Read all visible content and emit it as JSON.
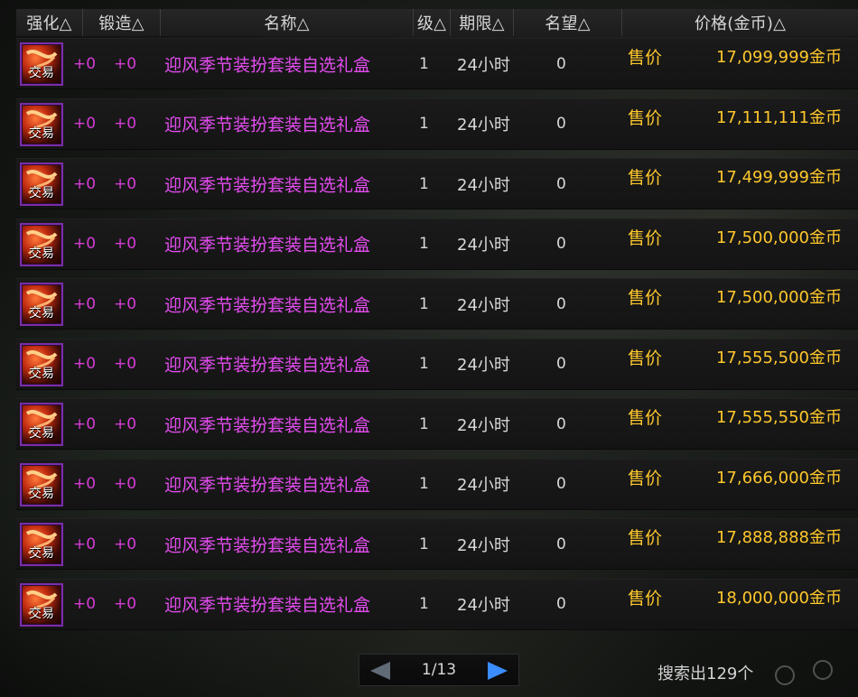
{
  "columns": {
    "qh": "强化△",
    "dz": "锻造△",
    "name": "名称△",
    "level": "级△",
    "term": "期限△",
    "fame": "名望△",
    "price": "价格(金币)△"
  },
  "rows": [
    {
      "icon": "gift-box-icon",
      "trade": "交易",
      "qh": "+0",
      "dz": "+0",
      "name": "迎风季节装扮套装自选礼盒",
      "level": "1",
      "term": "24小时",
      "fame": "0",
      "sale": "售价",
      "price": "17,099,999金币"
    },
    {
      "icon": "gift-box-icon",
      "trade": "交易",
      "qh": "+0",
      "dz": "+0",
      "name": "迎风季节装扮套装自选礼盒",
      "level": "1",
      "term": "24小时",
      "fame": "0",
      "sale": "售价",
      "price": "17,111,111金币"
    },
    {
      "icon": "gift-box-icon",
      "trade": "交易",
      "qh": "+0",
      "dz": "+0",
      "name": "迎风季节装扮套装自选礼盒",
      "level": "1",
      "term": "24小时",
      "fame": "0",
      "sale": "售价",
      "price": "17,499,999金币"
    },
    {
      "icon": "gift-box-icon",
      "trade": "交易",
      "qh": "+0",
      "dz": "+0",
      "name": "迎风季节装扮套装自选礼盒",
      "level": "1",
      "term": "24小时",
      "fame": "0",
      "sale": "售价",
      "price": "17,500,000金币"
    },
    {
      "icon": "gift-box-icon",
      "trade": "交易",
      "qh": "+0",
      "dz": "+0",
      "name": "迎风季节装扮套装自选礼盒",
      "level": "1",
      "term": "24小时",
      "fame": "0",
      "sale": "售价",
      "price": "17,500,000金币"
    },
    {
      "icon": "gift-box-icon",
      "trade": "交易",
      "qh": "+0",
      "dz": "+0",
      "name": "迎风季节装扮套装自选礼盒",
      "level": "1",
      "term": "24小时",
      "fame": "0",
      "sale": "售价",
      "price": "17,555,500金币"
    },
    {
      "icon": "gift-box-icon",
      "trade": "交易",
      "qh": "+0",
      "dz": "+0",
      "name": "迎风季节装扮套装自选礼盒",
      "level": "1",
      "term": "24小时",
      "fame": "0",
      "sale": "售价",
      "price": "17,555,550金币"
    },
    {
      "icon": "gift-box-icon",
      "trade": "交易",
      "qh": "+0",
      "dz": "+0",
      "name": "迎风季节装扮套装自选礼盒",
      "level": "1",
      "term": "24小时",
      "fame": "0",
      "sale": "售价",
      "price": "17,666,000金币"
    },
    {
      "icon": "gift-box-icon",
      "trade": "交易",
      "qh": "+0",
      "dz": "+0",
      "name": "迎风季节装扮套装自选礼盒",
      "level": "1",
      "term": "24小时",
      "fame": "0",
      "sale": "售价",
      "price": "17,888,888金币"
    },
    {
      "icon": "gift-box-icon",
      "trade": "交易",
      "qh": "+0",
      "dz": "+0",
      "name": "迎风季节装扮套装自选礼盒",
      "level": "1",
      "term": "24小时",
      "fame": "0",
      "sale": "售价",
      "price": "18,000,000金币"
    }
  ],
  "pagination": {
    "page": "1/13",
    "prev_icon": "arrow-left-icon",
    "next_icon": "arrow-right-icon"
  },
  "status": {
    "result_count": "搜索出129个"
  },
  "colors": {
    "name": "#e44cf0",
    "enhance": "#d63cd6",
    "price": "#ffc82c",
    "text": "#d8d8d8"
  }
}
